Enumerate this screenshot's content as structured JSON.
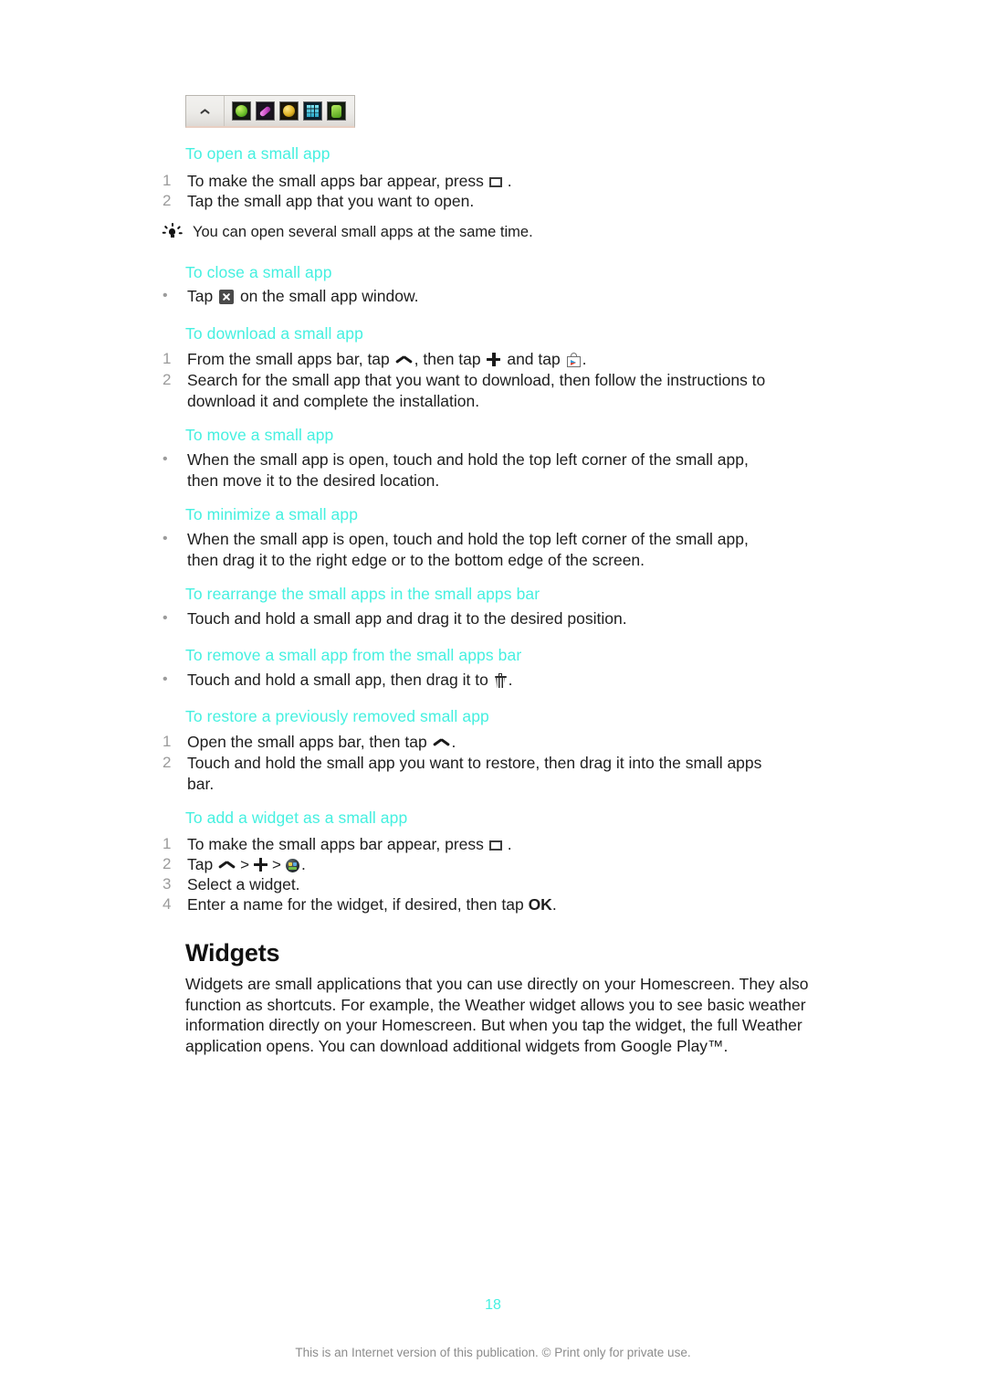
{
  "figure": {
    "name": "small-apps-bar-screenshot",
    "handle_icon": "chevron-up-icon",
    "app_icons": [
      {
        "name": "small-app-icon-browser",
        "color": "#6fc22c"
      },
      {
        "name": "small-app-icon-notes",
        "color": "#d04ecb"
      },
      {
        "name": "small-app-icon-timer",
        "color": "#e0b224"
      },
      {
        "name": "small-app-icon-calculator",
        "color": "#2aa8c8"
      },
      {
        "name": "small-app-icon-fifth",
        "color": "#4e9e19"
      }
    ]
  },
  "sections": [
    {
      "heading": "To open a small app",
      "items": [
        {
          "marker": "1",
          "before": "To make the small apps bar appear, press ",
          "icon": "recents-icon",
          "after": "."
        },
        {
          "marker": "2",
          "before": "Tap the small app that you want to open.",
          "icon": "",
          "after": ""
        }
      ]
    },
    {
      "heading": "To close a small app",
      "items": [
        {
          "marker": "•",
          "before": "Tap ",
          "icon": "close-icon",
          "after": " on the small app window."
        }
      ]
    },
    {
      "heading": "To download a small app",
      "items": [
        {
          "marker": "1",
          "before": "From the small apps bar, tap ",
          "icon": "chevron-up-icon",
          "mid": ", then tap ",
          "icon2": "plus-icon",
          "mid2": " and tap ",
          "icon3": "play-store-icon",
          "after": "."
        },
        {
          "marker": "2",
          "before": "Search for the small app that you want to download, then follow the instructions to download it and complete the installation.",
          "icon": "",
          "after": ""
        }
      ]
    },
    {
      "heading": "To move a small app",
      "items": [
        {
          "marker": "•",
          "before": "When the small app is open, touch and hold the top left corner of the small app, then move it to the desired location.",
          "icon": "",
          "after": ""
        }
      ]
    },
    {
      "heading": "To minimize a small app",
      "items": [
        {
          "marker": "•",
          "before": "When the small app is open, touch and hold the top left corner of the small app, then drag it to the right edge or to the bottom edge of the screen.",
          "icon": "",
          "after": ""
        }
      ]
    },
    {
      "heading": "To rearrange the small apps in the small apps bar",
      "items": [
        {
          "marker": "•",
          "before": "Touch and hold a small app and drag it to the desired position.",
          "icon": "",
          "after": ""
        }
      ]
    },
    {
      "heading": "To remove a small app from the small apps bar",
      "items": [
        {
          "marker": "•",
          "before": "Touch and hold a small app, then drag it to ",
          "icon": "trash-icon",
          "after": "."
        }
      ]
    },
    {
      "heading": "To restore a previously removed small app",
      "items": [
        {
          "marker": "1",
          "before": "Open the small apps bar, then tap ",
          "icon": "chevron-up-icon",
          "after": "."
        },
        {
          "marker": "2",
          "before": "Touch and hold the small app you want to restore, then drag it into the small apps bar.",
          "icon": "",
          "after": ""
        }
      ]
    },
    {
      "heading": "To add a widget as a small app",
      "items": [
        {
          "marker": "1",
          "before": "To make the small apps bar appear, press ",
          "icon": "recents-icon",
          "after": "."
        },
        {
          "marker": "2",
          "before": "Tap ",
          "icon": "chevron-up-icon",
          "mid": ">",
          "icon2": "plus-icon",
          "mid2": ">",
          "icon3": "widget-icon",
          "after": "."
        },
        {
          "marker": "3",
          "before": "Select a widget.",
          "icon": "",
          "after": ""
        },
        {
          "marker": "4",
          "before": "Enter a name for the widget, if desired, then tap ",
          "bold": "OK",
          "after": "."
        }
      ]
    }
  ],
  "tip": {
    "icon": "lightbulb-icon",
    "text": "You can open several small apps at the same time."
  },
  "widgets_section": {
    "heading": "Widgets",
    "paragraph": "Widgets are small applications that you can use directly on your Homescreen. They also function as shortcuts. For example, the Weather widget allows you to see basic weather information directly on your Homescreen. But when you tap the widget, the full Weather application opens. You can download additional widgets from Google Play™."
  },
  "footer": {
    "page_number": "18",
    "note": "This is an Internet version of this publication. © Print only for private use."
  },
  "colors": {
    "heading_cyan": "#45f0e0",
    "body_text": "#1e1e1e",
    "marker_gray": "#9b9b9b",
    "footer_gray": "#8c8c8c"
  }
}
